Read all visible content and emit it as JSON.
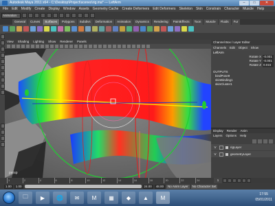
{
  "window": {
    "title": "Autodesk Maya 2011 x64 - C:\\Desktop\\Project\\scenes\\rig.ma* --- LeftArm",
    "min": "–",
    "max": "□",
    "close": "✕"
  },
  "menubar": [
    "File",
    "Edit",
    "Modify",
    "Create",
    "Display",
    "Window",
    "Assets",
    "Geometry Cache",
    "Create Deformers",
    "Edit Deformers",
    "Skeleton",
    "Skin",
    "Constrain",
    "Character",
    "Muscle",
    "Help"
  ],
  "status_line": {
    "mode": "Animation"
  },
  "shelf_tabs": [
    "General",
    "Curves",
    "Surfaces",
    "Polygons",
    "Subdivs",
    "Deformation",
    "Animation",
    "Dynamics",
    "Rendering",
    "PaintEffects",
    "Toon",
    "Muscle",
    "Fluids",
    "Fur"
  ],
  "shelf_active": 2,
  "shelf_icon_colors": [
    "#4a86c8",
    "#5fa35f",
    "#d2a24c",
    "#c25757",
    "#6aa0d8",
    "#8e6fc2",
    "#d8d84a",
    "#4ac0c0",
    "#c26fa8",
    "#80c060",
    "#5a8fd0",
    "#d07a40",
    "#7aa0c0",
    "#b0b060",
    "#60a0a0",
    "#a06060",
    "#6080c0",
    "#c0a040",
    "#50b080",
    "#9060b0",
    "#4a86c8",
    "#5fa35f",
    "#d2a24c",
    "#c25757",
    "#6aa0d8",
    "#8e6fc2",
    "#d8d84a",
    "#4ac0c0"
  ],
  "viewport_menu": [
    "View",
    "Shading",
    "Lighting",
    "Show",
    "Renderer",
    "Panels"
  ],
  "channel_box": {
    "header": "Channel Box / Layer Editor",
    "menu": [
      "Channels",
      "Edit",
      "Object",
      "Show"
    ],
    "node": "LeftArm",
    "attributes": [
      {
        "label": "Rotate X",
        "value": "-0.001"
      },
      {
        "label": "Rotate Y",
        "value": "-0.001"
      },
      {
        "label": "Rotate Z",
        "value": "0.015"
      }
    ],
    "outputs_label": "OUTPUTS",
    "outputs": [
      "bindPose9",
      "skinBinding1",
      "skinCluster1"
    ]
  },
  "layer_editor": {
    "tabs": [
      "Display",
      "Render",
      "Anim"
    ],
    "menu": [
      "Layers",
      "Options",
      "Help"
    ],
    "layers": [
      {
        "visible": "V",
        "name": "rigLayer"
      },
      {
        "visible": "V",
        "name": "geometryLayer"
      }
    ]
  },
  "time_slider": {
    "ticks": [
      "1",
      "2",
      "4",
      "6",
      "8",
      "10",
      "12",
      "14",
      "16",
      "18",
      "20",
      "22",
      "24"
    ],
    "current_frame": "1"
  },
  "range_slider": {
    "start": "1.00",
    "inner_start": "1.00",
    "end": "24.00",
    "outer_end": "48.00",
    "anim_layer": "No Anim Layer",
    "char_set": "No Character Set"
  },
  "taskbar": {
    "apps": [
      "🗀",
      "▶",
      "🌐",
      "✉",
      "M",
      "▦",
      "◆",
      "▲",
      "M"
    ],
    "active_index": 8,
    "time": "17:55",
    "date": "05/01/2011"
  },
  "colors": {
    "viewport_bg": "#7a7a7a",
    "manipulator_green": "#22cc33",
    "manipulator_red": "#dd2222",
    "manipulator_yellow": "#ffee00",
    "manipulator_blue": "#2233cc"
  }
}
